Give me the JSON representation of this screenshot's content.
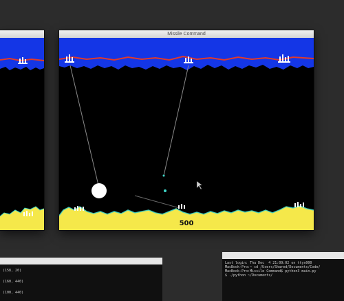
{
  "main_window": {
    "title": "Missile Command",
    "score": "500"
  },
  "left_window": {
    "title": ""
  },
  "console_left": {
    "title": "",
    "lines": [
      "(158, 20)",
      "(160, 440)",
      "(100, 440)"
    ]
  },
  "console_right": {
    "title": "",
    "lines": [
      "Last login: Thu Dec  4 21:09:02 on ttys000",
      "MacBook-Pro:~ cd /Users/Shared/Documents/Code/",
      "MacBook-Pro:Missile Command$ python3 main.py",
      "$ ./python ~/Documents/"
    ]
  },
  "colors": {
    "sky": "#1436e6",
    "ground": "#f5e84a",
    "city_line": "#e23a2a",
    "turret_glow": "#3fd6c8",
    "desktop": "#2c2c2c"
  }
}
